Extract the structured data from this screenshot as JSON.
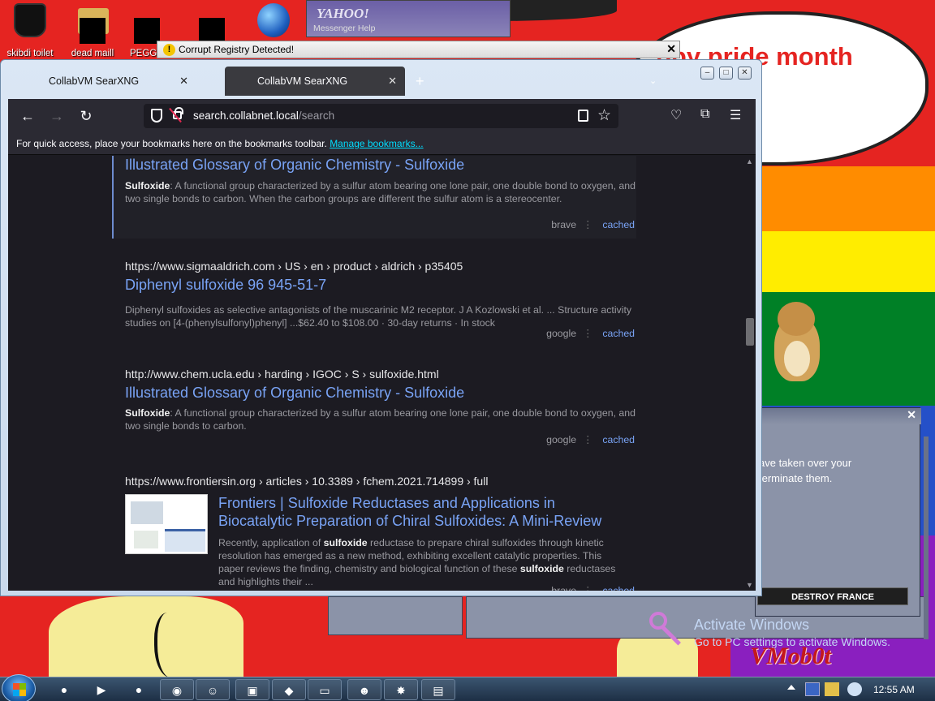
{
  "desktop": {
    "icons": [
      {
        "label": "skibdi toilet",
        "icon": "trash-bin-icon"
      },
      {
        "label": "dead maill",
        "icon": "mail-icon"
      },
      {
        "label": "PEGG",
        "icon": "app-icon"
      },
      {
        "label": "",
        "icon": "app-icon"
      },
      {
        "label": "",
        "icon": "internet-explorer-icon"
      }
    ],
    "speech_bubble_text": "ppy pride month",
    "yahoo": {
      "title": "YAHOO!",
      "menu": "Messenger    Help"
    }
  },
  "alert": {
    "text": "Corrupt Registry Detected!",
    "close": "✕"
  },
  "browser": {
    "tabs": [
      {
        "label": "CollabVM SearXNG",
        "active": false,
        "close": "✕"
      },
      {
        "label": "CollabVM SearXNG",
        "active": true,
        "close": "✕"
      }
    ],
    "new_tab": "+",
    "tab_overflow": "⌄",
    "window_controls": {
      "minimize": "–",
      "maximize": "□",
      "close": "✕"
    },
    "url": {
      "host": "search.collabnet.local",
      "path": "/search"
    },
    "bookmarks_bar": {
      "message": "For quick access, place your bookmarks here on the bookmarks toolbar. ",
      "link": "Manage bookmarks..."
    },
    "results": [
      {
        "url": "",
        "title": "Illustrated Glossary of Organic Chemistry - Sulfoxide",
        "content_bold": "Sulfoxide",
        "content": ": A functional group characterized by a sulfur atom bearing one lone pair, one double bond to oxygen, and two single bonds to carbon. When the carbon groups are different the sulfur atom is a stereocenter.",
        "engine": "brave",
        "cached": "cached"
      },
      {
        "url": "https://www.sigmaaldrich.com  › US › en › product › aldrich › p35405",
        "title": "Diphenyl sulfoxide 96 945-51-7",
        "content": "Diphenyl sulfoxides as selective antagonists of the muscarinic M2 receptor. J A Kozlowski et al. ... Structure activity studies on [4-(phenylsulfonyl)phenyl] ...$62.40 to $108.00 · 30-day returns · In stock",
        "engine": "google",
        "cached": "cached"
      },
      {
        "url": "http://www.chem.ucla.edu  › harding › IGOC › S › sulfoxide.html",
        "title": "Illustrated Glossary of Organic Chemistry - Sulfoxide",
        "content_bold": "Sulfoxide",
        "content": ": A functional group characterized by a sulfur atom bearing one lone pair, one double bond to oxygen, and two single bonds to carbon.",
        "engine": "google",
        "cached": "cached"
      },
      {
        "url": "https://www.frontiersin.org  › articles › 10.3389 › fchem.2021.714899 › full",
        "title": "Frontiers | Sulfoxide Reductases and Applications in Biocatalytic Preparation of Chiral Sulfoxides: A Mini-Review",
        "content_a": "Recently, application of ",
        "content_b": "sulfoxide",
        "content_c": " reductase to prepare chiral sulfoxides through kinetic resolution has emerged as a new method, exhibiting excellent catalytic properties. This paper reviews the finding, chemistry and biological function of these ",
        "content_d": "sulfoxide",
        "content_e": " reductases and highlights their ...",
        "engine": "brave",
        "cached": "cached"
      }
    ]
  },
  "popup": {
    "line1": "ave taken over your",
    "line2": "terminate them.",
    "button": "DESTROY FRANCE",
    "close": "✕"
  },
  "watermark": {
    "title": "Activate Windows",
    "subtitle": "Go to PC settings to activate Windows.",
    "logo": "VMob0t"
  },
  "taskbar": {
    "clock": "12:55 AM"
  }
}
